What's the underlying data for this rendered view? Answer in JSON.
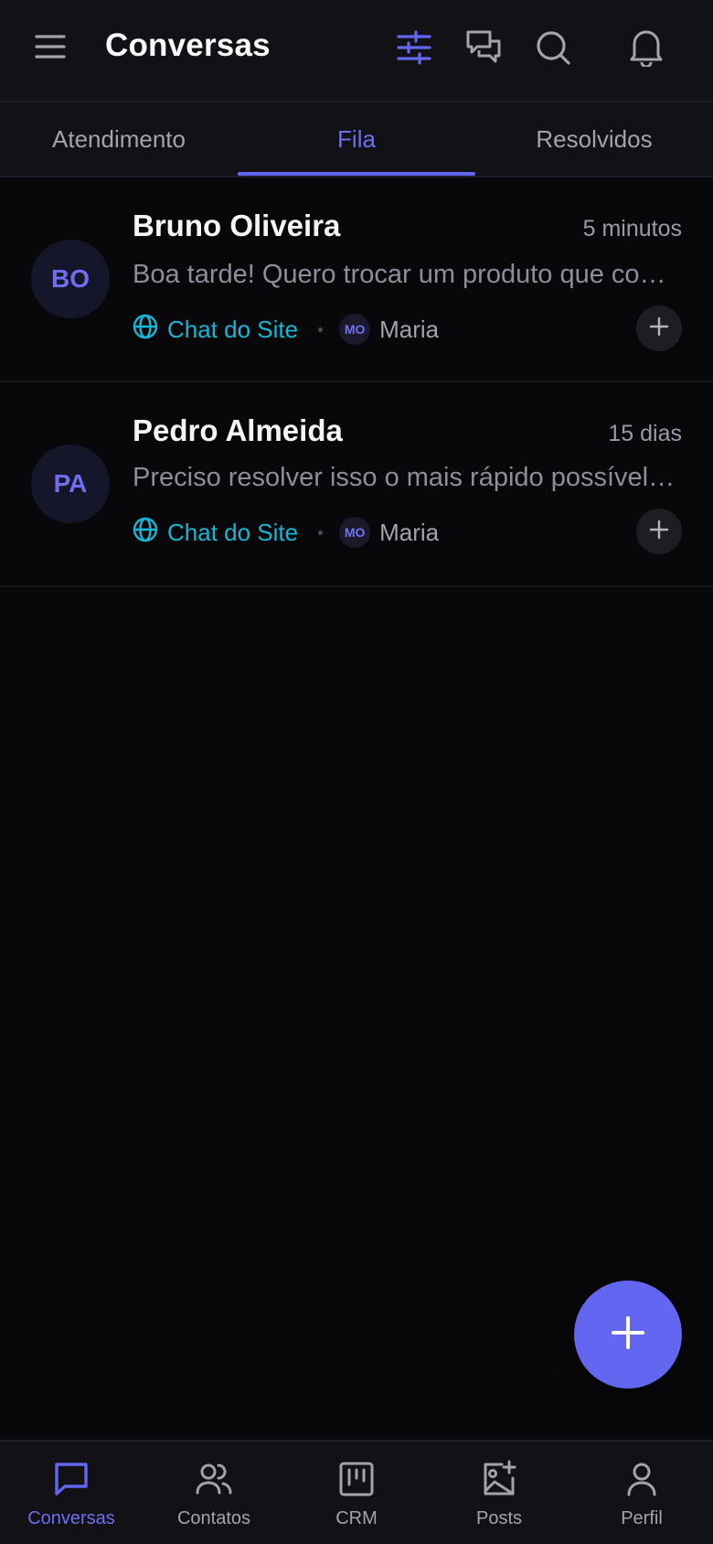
{
  "header": {
    "title": "Conversas",
    "icons": [
      "menu-icon",
      "filter-sliders-icon",
      "chats-icon",
      "search-icon",
      "bell-icon"
    ],
    "accent_color": "#6366f1"
  },
  "tabs": [
    {
      "label": "Atendimento",
      "active": false
    },
    {
      "label": "Fila",
      "active": true
    },
    {
      "label": "Resolvidos",
      "active": false
    }
  ],
  "conversations": [
    {
      "initials": "BO",
      "name": "Bruno Oliveira",
      "time": "5 minutos",
      "message": "Boa tarde! Quero trocar um produto que comprei no site",
      "channel": "Chat do Site",
      "agent_initials": "MO",
      "agent_name": "Maria"
    },
    {
      "initials": "PA",
      "name": "Pedro Almeida",
      "time": "15 dias",
      "message": "Preciso resolver isso o mais rápido possível, por favor",
      "channel": "Chat do Site",
      "agent_initials": "MO",
      "agent_name": "Maria"
    }
  ],
  "fab": {
    "icon": "plus-icon"
  },
  "bottom_nav": [
    {
      "label": "Conversas",
      "icon": "chat-bubble-icon",
      "active": true
    },
    {
      "label": "Contatos",
      "icon": "users-icon",
      "active": false
    },
    {
      "label": "CRM",
      "icon": "kanban-icon",
      "active": false
    },
    {
      "label": "Posts",
      "icon": "image-plus-icon",
      "active": false
    },
    {
      "label": "Perfil",
      "icon": "user-icon",
      "active": false
    }
  ]
}
